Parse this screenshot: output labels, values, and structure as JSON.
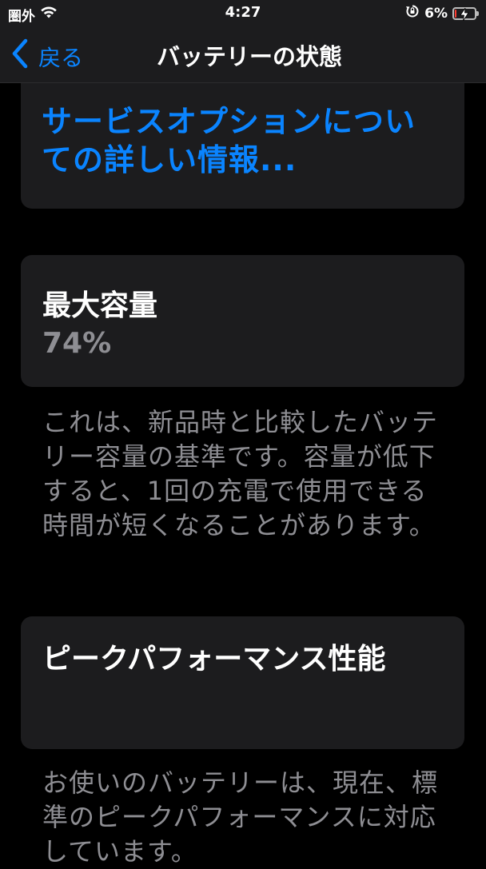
{
  "status_bar": {
    "carrier": "圏外",
    "time": "4:27",
    "battery_percent": "6%",
    "battery_level": 0.06,
    "icons": [
      "wifi-icon",
      "rotation-lock-icon",
      "battery-icon",
      "charging-bolt-icon"
    ]
  },
  "nav": {
    "back_label": "戻る",
    "title": "バッテリーの状態"
  },
  "service_link": {
    "text": "サービスオプションについての詳しい情報..."
  },
  "capacity": {
    "title": "最大容量",
    "value": "74%",
    "description": "これは、新品時と比較したバッテリー容量の基準です。容量が低下すると、1回の充電で使用できる時間が短くなることがあります。"
  },
  "peak": {
    "title": "ピークパフォーマンス性能",
    "description": "お使いのバッテリーは、現在、標準のピークパフォーマンスに対応しています。"
  },
  "colors": {
    "accent": "#0a84ff",
    "background": "#000000",
    "card": "#1c1c1e",
    "secondary_text": "#8e8e93",
    "battery_low": "#ff3b30"
  }
}
